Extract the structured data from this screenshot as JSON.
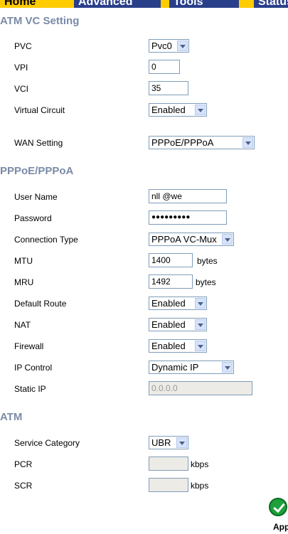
{
  "nav": {
    "home": "Home",
    "advanced": "Advanced",
    "tools": "Tools",
    "status": "Status"
  },
  "atm_vc": {
    "title": "ATM VC Setting",
    "pvc_label": "PVC",
    "pvc_value": "Pvc0",
    "vpi_label": "VPI",
    "vpi_value": "0",
    "vci_label": "VCI",
    "vci_value": "35",
    "vc_label": "Virtual Circuit",
    "vc_value": "Enabled",
    "wan_label": "WAN Setting",
    "wan_value": "PPPoE/PPPoA"
  },
  "pppoe": {
    "title": "PPPoE/PPPoA",
    "user_label": "User Name",
    "user_value": "nll          @we",
    "pass_label": "Password",
    "pass_value": "●●●●●●●●●",
    "conn_label": "Connection Type",
    "conn_value": "PPPoA VC-Mux",
    "mtu_label": "MTU",
    "mtu_value": "1400",
    "mtu_unit": "bytes",
    "mru_label": "MRU",
    "mru_value": "1492",
    "mru_unit": "bytes",
    "route_label": "Default Route",
    "route_value": "Enabled",
    "nat_label": "NAT",
    "nat_value": "Enabled",
    "fw_label": "Firewall",
    "fw_value": "Enabled",
    "ipc_label": "IP Control",
    "ipc_value": "Dynamic IP",
    "sip_label": "Static IP",
    "sip_placeholder": "0.0.0.0"
  },
  "atm": {
    "title": "ATM",
    "svc_label": "Service Category",
    "svc_value": "UBR",
    "pcr_label": "PCR",
    "pcr_unit": "kbps",
    "scr_label": "SCR",
    "scr_unit": "kbps"
  },
  "apply": {
    "label": "Apply"
  },
  "colors": {
    "nav_bar": "#ffcc00",
    "section_title": "#7a8aa8",
    "apply_green": "#1fa03a"
  }
}
